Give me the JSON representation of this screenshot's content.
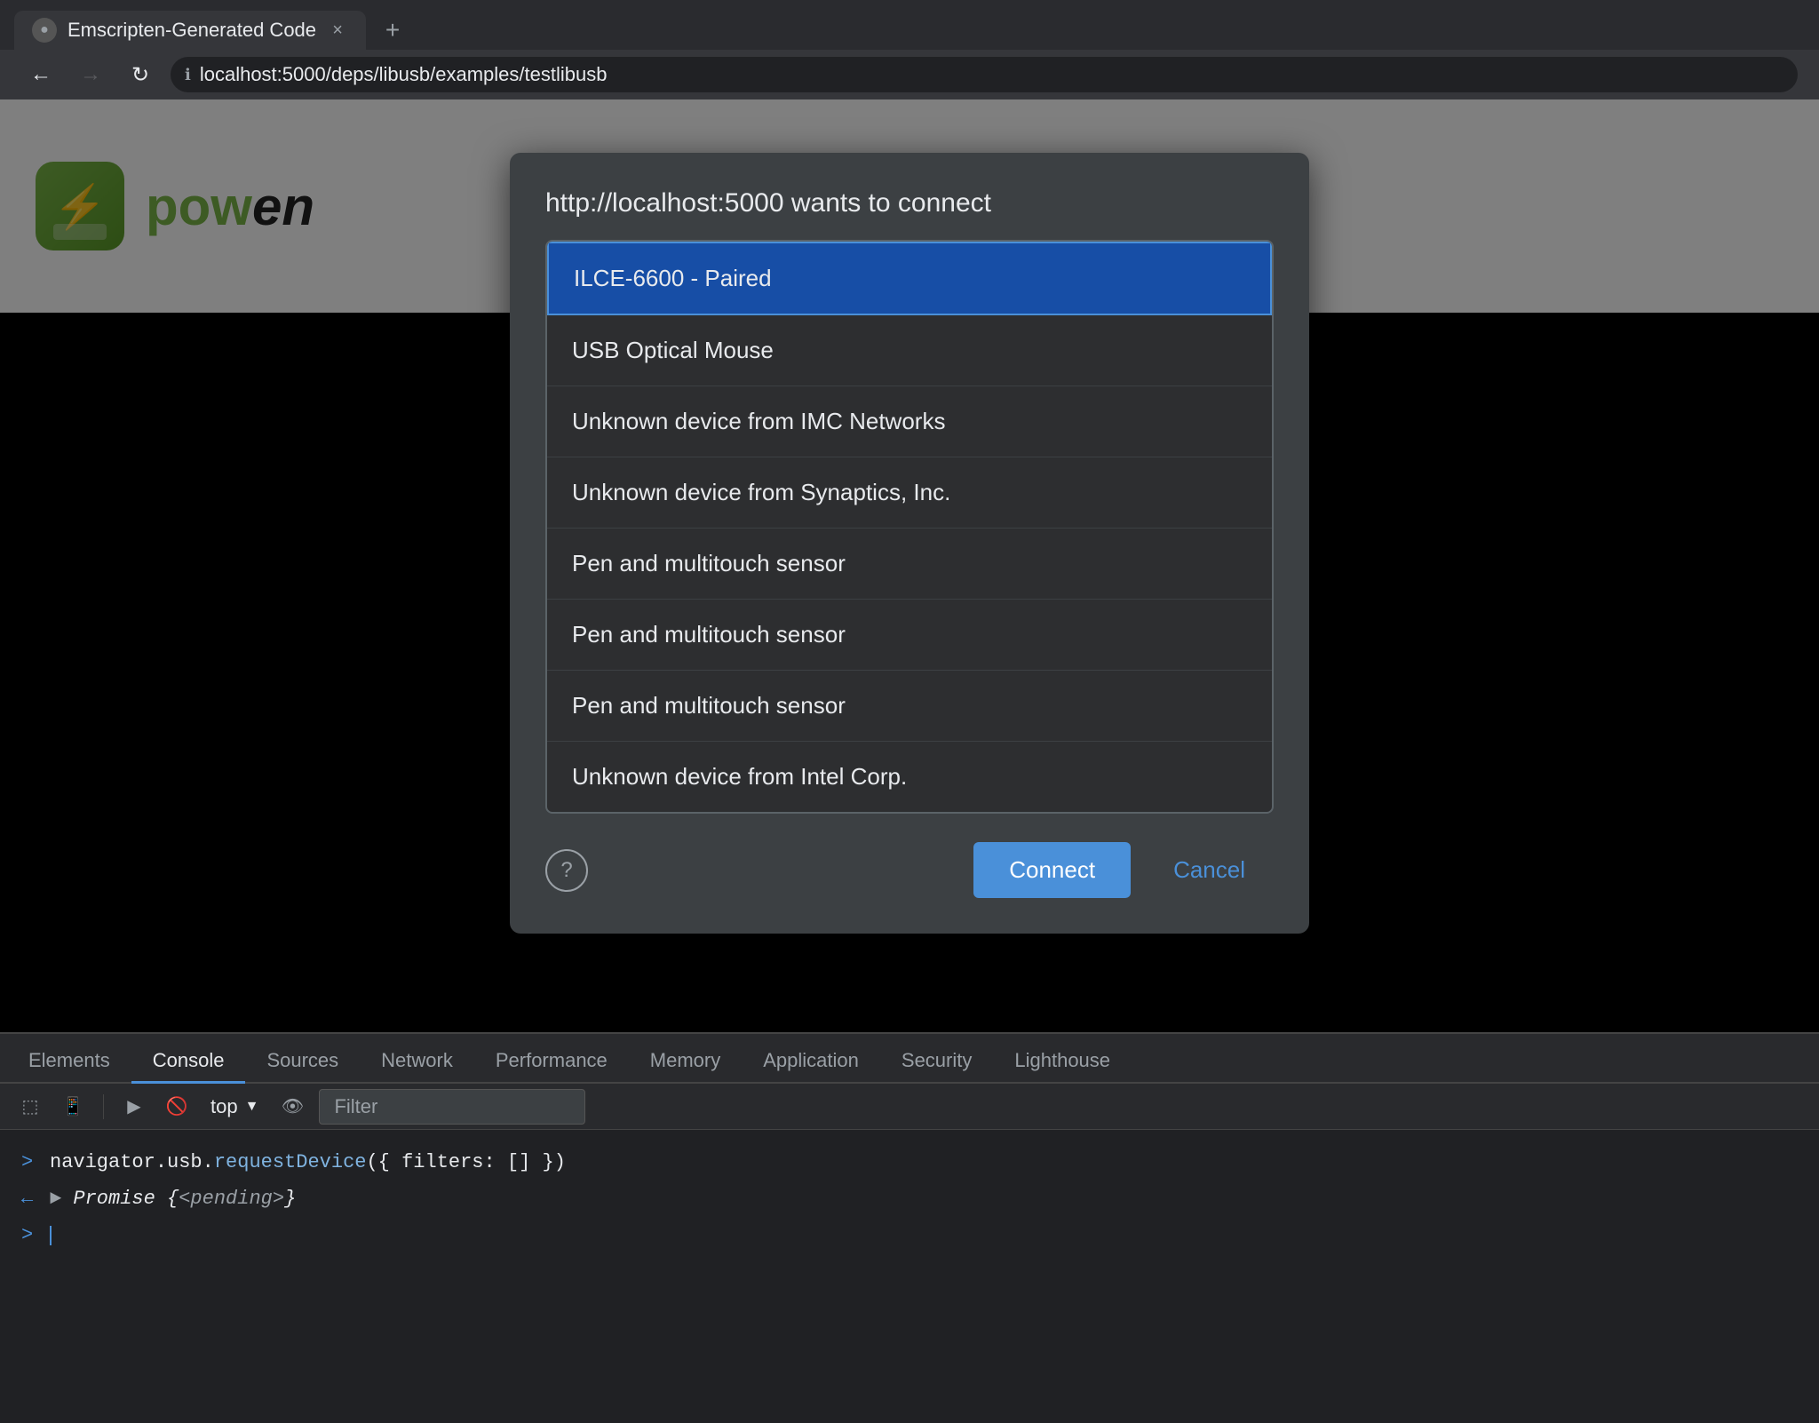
{
  "browser": {
    "tab": {
      "favicon_symbol": "●",
      "title": "Emscripten-Generated Code",
      "close_label": "×",
      "new_tab_label": "+"
    },
    "nav": {
      "back_label": "←",
      "forward_label": "→",
      "reload_label": "↻",
      "url": "localhost:5000/deps/libusb/examples/testlibusb"
    }
  },
  "page": {
    "app_icon_symbol": "⚡",
    "app_title_green": "pow",
    "app_title_black": "en"
  },
  "dialog": {
    "title": "http://localhost:5000 wants to connect",
    "devices": [
      {
        "label": "ILCE-6600 - Paired",
        "selected": true
      },
      {
        "label": "USB Optical Mouse",
        "selected": false
      },
      {
        "label": "Unknown device from IMC Networks",
        "selected": false
      },
      {
        "label": "Unknown device from Synaptics, Inc.",
        "selected": false
      },
      {
        "label": "Pen and multitouch sensor",
        "selected": false
      },
      {
        "label": "Pen and multitouch sensor",
        "selected": false
      },
      {
        "label": "Pen and multitouch sensor",
        "selected": false
      },
      {
        "label": "Unknown device from Intel Corp.",
        "selected": false
      }
    ],
    "connect_label": "Connect",
    "cancel_label": "Cancel"
  },
  "devtools": {
    "tabs": [
      {
        "label": "Elements",
        "active": false
      },
      {
        "label": "Console",
        "active": true
      },
      {
        "label": "Sources",
        "active": false
      },
      {
        "label": "Network",
        "active": false
      },
      {
        "label": "Performance",
        "active": false
      },
      {
        "label": "Memory",
        "active": false
      },
      {
        "label": "Application",
        "active": false
      },
      {
        "label": "Security",
        "active": false
      },
      {
        "label": "Lighthouse",
        "active": false
      }
    ],
    "toolbar": {
      "context": "top",
      "filter_placeholder": "Filter"
    },
    "console": {
      "line1_prompt": ">",
      "line1_code": "navigator.usb.requestDevice({ filters: [] })",
      "line2_prompt": "←",
      "line2_code": "▶ Promise {<pending>}",
      "line3_prompt": ">"
    }
  }
}
